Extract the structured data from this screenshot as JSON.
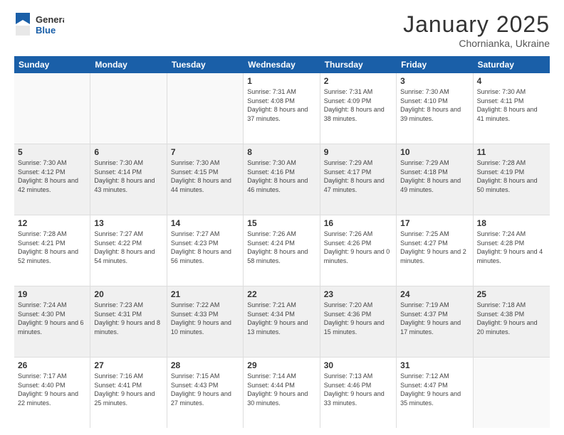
{
  "logo": {
    "general": "General",
    "blue": "Blue"
  },
  "header": {
    "month": "January 2025",
    "location": "Chornianka, Ukraine"
  },
  "weekdays": [
    "Sunday",
    "Monday",
    "Tuesday",
    "Wednesday",
    "Thursday",
    "Friday",
    "Saturday"
  ],
  "rows": [
    [
      {
        "day": "",
        "sunrise": "",
        "sunset": "",
        "daylight": "",
        "empty": true
      },
      {
        "day": "",
        "sunrise": "",
        "sunset": "",
        "daylight": "",
        "empty": true
      },
      {
        "day": "",
        "sunrise": "",
        "sunset": "",
        "daylight": "",
        "empty": true
      },
      {
        "day": "1",
        "sunrise": "Sunrise: 7:31 AM",
        "sunset": "Sunset: 4:08 PM",
        "daylight": "Daylight: 8 hours and 37 minutes."
      },
      {
        "day": "2",
        "sunrise": "Sunrise: 7:31 AM",
        "sunset": "Sunset: 4:09 PM",
        "daylight": "Daylight: 8 hours and 38 minutes."
      },
      {
        "day": "3",
        "sunrise": "Sunrise: 7:30 AM",
        "sunset": "Sunset: 4:10 PM",
        "daylight": "Daylight: 8 hours and 39 minutes."
      },
      {
        "day": "4",
        "sunrise": "Sunrise: 7:30 AM",
        "sunset": "Sunset: 4:11 PM",
        "daylight": "Daylight: 8 hours and 41 minutes."
      }
    ],
    [
      {
        "day": "5",
        "sunrise": "Sunrise: 7:30 AM",
        "sunset": "Sunset: 4:12 PM",
        "daylight": "Daylight: 8 hours and 42 minutes."
      },
      {
        "day": "6",
        "sunrise": "Sunrise: 7:30 AM",
        "sunset": "Sunset: 4:14 PM",
        "daylight": "Daylight: 8 hours and 43 minutes."
      },
      {
        "day": "7",
        "sunrise": "Sunrise: 7:30 AM",
        "sunset": "Sunset: 4:15 PM",
        "daylight": "Daylight: 8 hours and 44 minutes."
      },
      {
        "day": "8",
        "sunrise": "Sunrise: 7:30 AM",
        "sunset": "Sunset: 4:16 PM",
        "daylight": "Daylight: 8 hours and 46 minutes."
      },
      {
        "day": "9",
        "sunrise": "Sunrise: 7:29 AM",
        "sunset": "Sunset: 4:17 PM",
        "daylight": "Daylight: 8 hours and 47 minutes."
      },
      {
        "day": "10",
        "sunrise": "Sunrise: 7:29 AM",
        "sunset": "Sunset: 4:18 PM",
        "daylight": "Daylight: 8 hours and 49 minutes."
      },
      {
        "day": "11",
        "sunrise": "Sunrise: 7:28 AM",
        "sunset": "Sunset: 4:19 PM",
        "daylight": "Daylight: 8 hours and 50 minutes."
      }
    ],
    [
      {
        "day": "12",
        "sunrise": "Sunrise: 7:28 AM",
        "sunset": "Sunset: 4:21 PM",
        "daylight": "Daylight: 8 hours and 52 minutes."
      },
      {
        "day": "13",
        "sunrise": "Sunrise: 7:27 AM",
        "sunset": "Sunset: 4:22 PM",
        "daylight": "Daylight: 8 hours and 54 minutes."
      },
      {
        "day": "14",
        "sunrise": "Sunrise: 7:27 AM",
        "sunset": "Sunset: 4:23 PM",
        "daylight": "Daylight: 8 hours and 56 minutes."
      },
      {
        "day": "15",
        "sunrise": "Sunrise: 7:26 AM",
        "sunset": "Sunset: 4:24 PM",
        "daylight": "Daylight: 8 hours and 58 minutes."
      },
      {
        "day": "16",
        "sunrise": "Sunrise: 7:26 AM",
        "sunset": "Sunset: 4:26 PM",
        "daylight": "Daylight: 9 hours and 0 minutes."
      },
      {
        "day": "17",
        "sunrise": "Sunrise: 7:25 AM",
        "sunset": "Sunset: 4:27 PM",
        "daylight": "Daylight: 9 hours and 2 minutes."
      },
      {
        "day": "18",
        "sunrise": "Sunrise: 7:24 AM",
        "sunset": "Sunset: 4:28 PM",
        "daylight": "Daylight: 9 hours and 4 minutes."
      }
    ],
    [
      {
        "day": "19",
        "sunrise": "Sunrise: 7:24 AM",
        "sunset": "Sunset: 4:30 PM",
        "daylight": "Daylight: 9 hours and 6 minutes."
      },
      {
        "day": "20",
        "sunrise": "Sunrise: 7:23 AM",
        "sunset": "Sunset: 4:31 PM",
        "daylight": "Daylight: 9 hours and 8 minutes."
      },
      {
        "day": "21",
        "sunrise": "Sunrise: 7:22 AM",
        "sunset": "Sunset: 4:33 PM",
        "daylight": "Daylight: 9 hours and 10 minutes."
      },
      {
        "day": "22",
        "sunrise": "Sunrise: 7:21 AM",
        "sunset": "Sunset: 4:34 PM",
        "daylight": "Daylight: 9 hours and 13 minutes."
      },
      {
        "day": "23",
        "sunrise": "Sunrise: 7:20 AM",
        "sunset": "Sunset: 4:36 PM",
        "daylight": "Daylight: 9 hours and 15 minutes."
      },
      {
        "day": "24",
        "sunrise": "Sunrise: 7:19 AM",
        "sunset": "Sunset: 4:37 PM",
        "daylight": "Daylight: 9 hours and 17 minutes."
      },
      {
        "day": "25",
        "sunrise": "Sunrise: 7:18 AM",
        "sunset": "Sunset: 4:38 PM",
        "daylight": "Daylight: 9 hours and 20 minutes."
      }
    ],
    [
      {
        "day": "26",
        "sunrise": "Sunrise: 7:17 AM",
        "sunset": "Sunset: 4:40 PM",
        "daylight": "Daylight: 9 hours and 22 minutes."
      },
      {
        "day": "27",
        "sunrise": "Sunrise: 7:16 AM",
        "sunset": "Sunset: 4:41 PM",
        "daylight": "Daylight: 9 hours and 25 minutes."
      },
      {
        "day": "28",
        "sunrise": "Sunrise: 7:15 AM",
        "sunset": "Sunset: 4:43 PM",
        "daylight": "Daylight: 9 hours and 27 minutes."
      },
      {
        "day": "29",
        "sunrise": "Sunrise: 7:14 AM",
        "sunset": "Sunset: 4:44 PM",
        "daylight": "Daylight: 9 hours and 30 minutes."
      },
      {
        "day": "30",
        "sunrise": "Sunrise: 7:13 AM",
        "sunset": "Sunset: 4:46 PM",
        "daylight": "Daylight: 9 hours and 33 minutes."
      },
      {
        "day": "31",
        "sunrise": "Sunrise: 7:12 AM",
        "sunset": "Sunset: 4:47 PM",
        "daylight": "Daylight: 9 hours and 35 minutes."
      },
      {
        "day": "",
        "sunrise": "",
        "sunset": "",
        "daylight": "",
        "empty": true
      }
    ]
  ]
}
